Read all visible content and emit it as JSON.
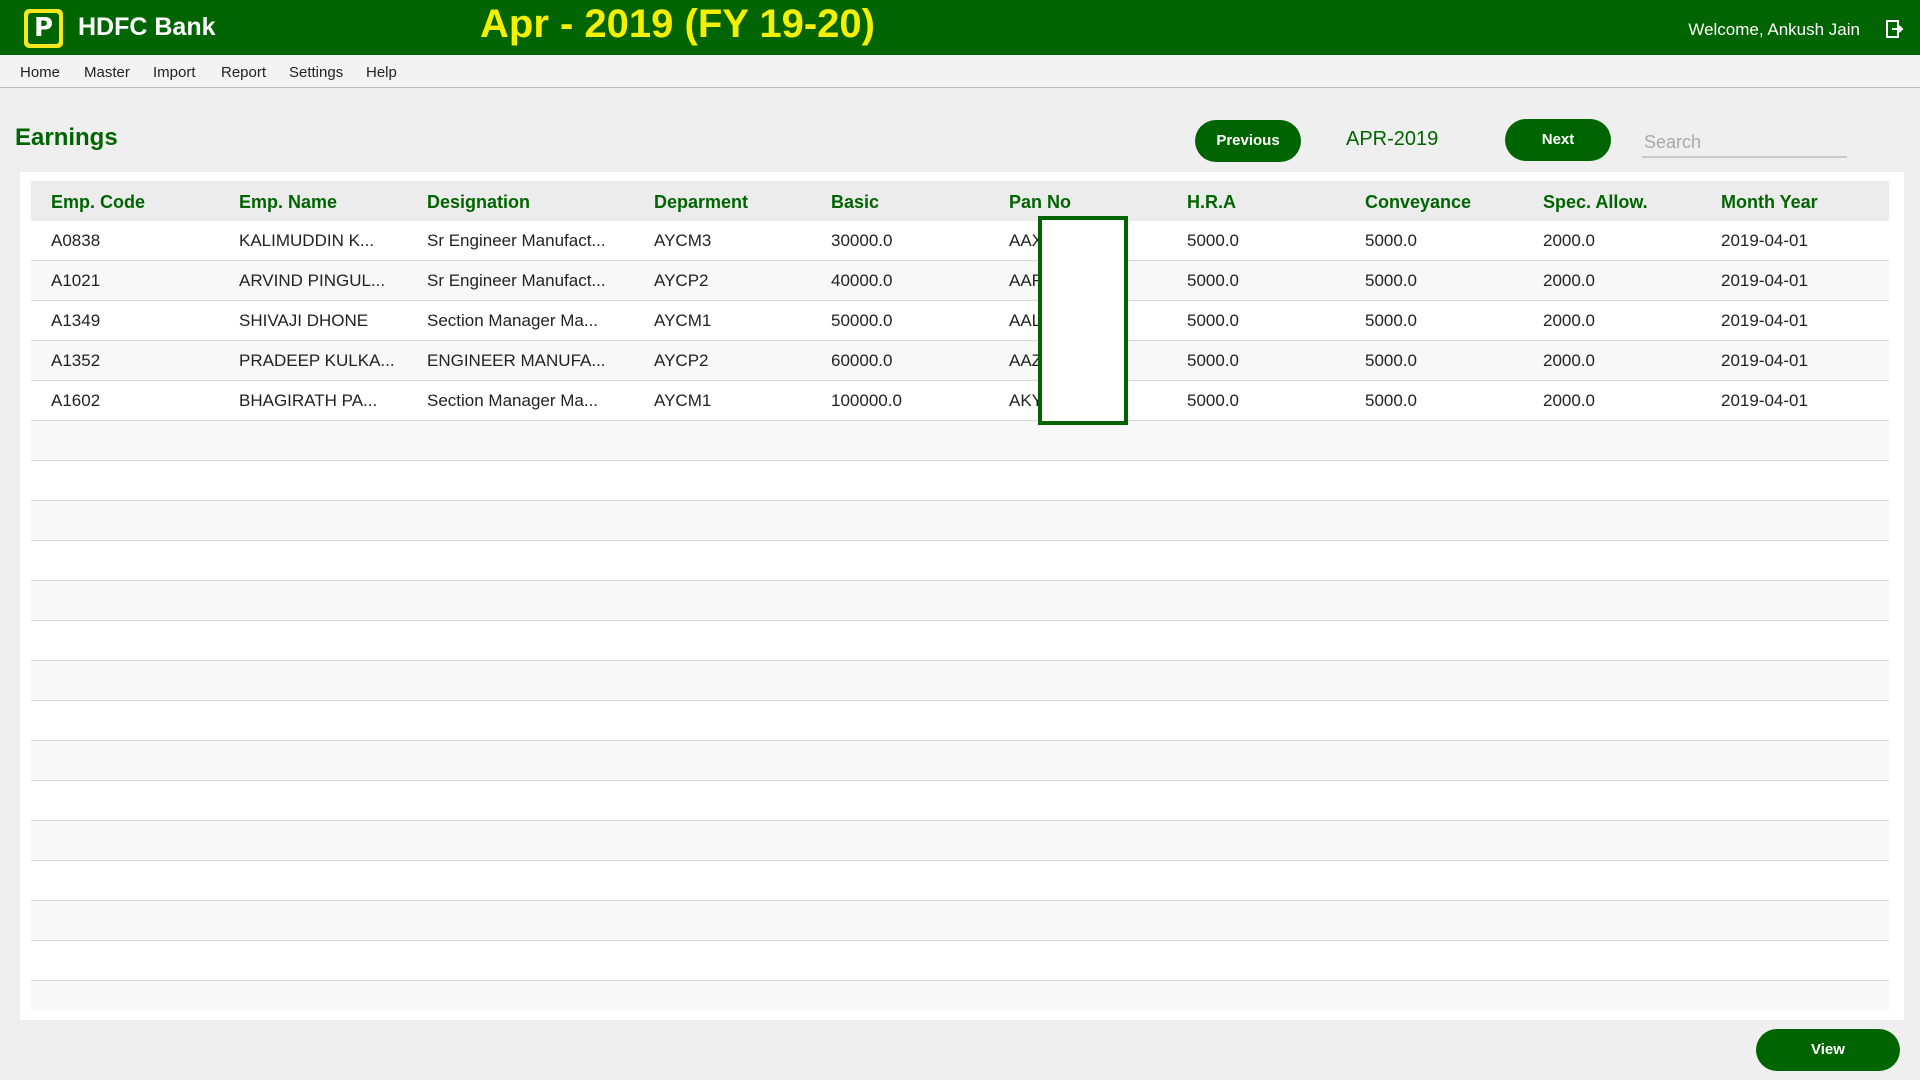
{
  "app": {
    "name": "HDFC Bank",
    "logo_letter": "P",
    "period_title": "Apr - 2019 (FY 19-20)",
    "welcome": "Welcome, Ankush Jain"
  },
  "menu": [
    "Home",
    "Master",
    "Import",
    "Report",
    "Settings",
    "Help"
  ],
  "page": {
    "title": "Earnings",
    "previous_label": "Previous",
    "month": "APR-2019",
    "next_label": "Next",
    "search_placeholder": "Search",
    "view_label": "View"
  },
  "table": {
    "columns": [
      "Emp. Code",
      "Emp. Name",
      "Designation",
      "Deparment",
      "Basic",
      "Pan No",
      "H.R.A",
      "Conveyance",
      "Spec. Allow.",
      "Month Year"
    ],
    "rows": [
      [
        "A0838",
        "KALIMUDDIN K...",
        "Sr Engineer Manufact...",
        "AYCM3",
        "30000.0",
        "AAX",
        "5000.0",
        "5000.0",
        "2000.0",
        "2019-04-01"
      ],
      [
        "A1021",
        "ARVIND PINGUL...",
        "Sr Engineer Manufact...",
        "AYCP2",
        "40000.0",
        "AAF",
        "5000.0",
        "5000.0",
        "2000.0",
        "2019-04-01"
      ],
      [
        "A1349",
        "SHIVAJI DHONE",
        "Section Manager Ma...",
        "AYCM1",
        "50000.0",
        "AAL",
        "5000.0",
        "5000.0",
        "2000.0",
        "2019-04-01"
      ],
      [
        "A1352",
        "PRADEEP KULKA...",
        "ENGINEER MANUFA...",
        "AYCP2",
        "60000.0",
        "AAZ",
        "5000.0",
        "5000.0",
        "2000.0",
        "2019-04-01"
      ],
      [
        "A1602",
        "BHAGIRATH PA...",
        "Section Manager Ma...",
        "AYCM1",
        "100000.0",
        "AKY",
        "5000.0",
        "5000.0",
        "2000.0",
        "2019-04-01"
      ]
    ]
  },
  "colors": {
    "brand_green": "#006400",
    "title_yellow": "#f5f000"
  },
  "icons": {
    "logo": "p-logo-icon",
    "logout": "logout-icon"
  }
}
